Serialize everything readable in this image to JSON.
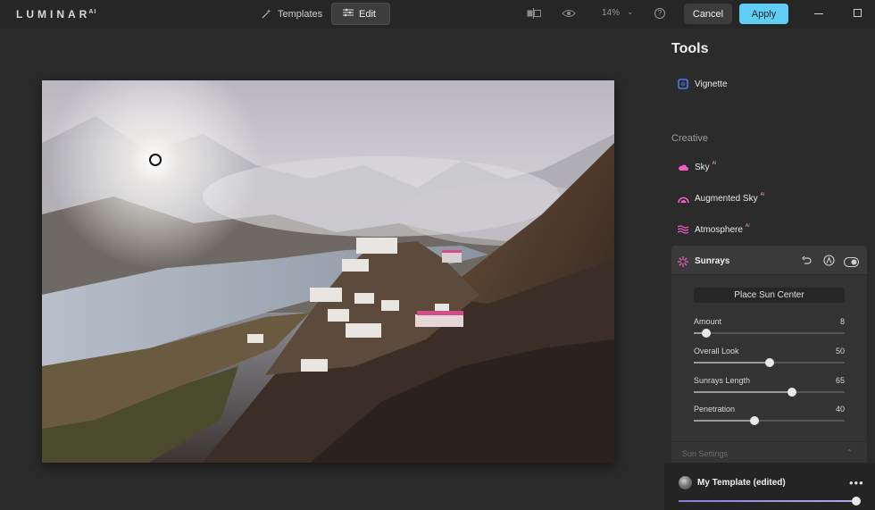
{
  "app": {
    "logo_text": "LUMINAR",
    "logo_sup": "AI"
  },
  "topbar": {
    "templates_label": "Templates",
    "edit_label": "Edit",
    "zoom_level": "14%",
    "cancel_label": "Cancel",
    "apply_label": "Apply"
  },
  "panel": {
    "title": "Tools",
    "vignette_label": "Vignette",
    "creative_label": "Creative",
    "creative_tools": [
      {
        "label": "Sky",
        "ai": "AI"
      },
      {
        "label": "Augmented Sky",
        "ai": "AI"
      },
      {
        "label": "Atmosphere",
        "ai": "AI"
      }
    ],
    "sunrays": {
      "title": "Sunrays",
      "place_button": "Place Sun Center",
      "sliders": [
        {
          "label": "Amount",
          "value": "8",
          "fraction": 0.08
        },
        {
          "label": "Overall Look",
          "value": "50",
          "fraction": 0.5
        },
        {
          "label": "Sunrays Length",
          "value": "65",
          "fraction": 0.65
        },
        {
          "label": "Penetration",
          "value": "40",
          "fraction": 0.4
        }
      ],
      "sun_settings_label": "Sun Settings"
    }
  },
  "footer": {
    "template_name": "My Template (edited)",
    "template_amount": 1.0
  },
  "colors": {
    "accent_apply": "#62cdf3",
    "vignette_icon": "#4a7bf0",
    "creative_icon": "#f25ec7"
  }
}
